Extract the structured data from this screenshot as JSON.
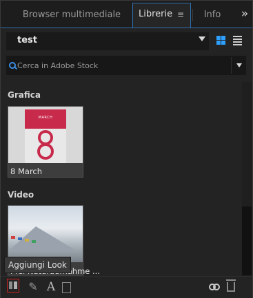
{
  "tabs": {
    "browser": "Browser multimediale",
    "librerie": "Librerie",
    "librerie_menu": "≡",
    "info": "Info",
    "overflow": "»"
  },
  "library": {
    "name": "test",
    "view_mode": "grid"
  },
  "search": {
    "placeholder": "Cerca in Adobe Stock"
  },
  "sections": [
    {
      "title": "Grafica",
      "items": [
        {
          "label": "8 March",
          "poster_text": "MARCH"
        }
      ]
    },
    {
      "title": "Video",
      "items": [
        {
          "label": "Pfel Naturaufnahme ..."
        }
      ]
    }
  ],
  "tooltip": "Aggiungi Look",
  "toolbar": {
    "text_label": "A"
  },
  "colors": {
    "accent": "#2f6fae",
    "brand_red": "#c82a4c",
    "highlight": "#d02020"
  },
  "icons": [
    "search-icon",
    "grid-view-icon",
    "list-view-icon",
    "add-look-icon",
    "brush-icon",
    "text-icon",
    "square-icon",
    "creative-cloud-icon",
    "trash-icon"
  ]
}
